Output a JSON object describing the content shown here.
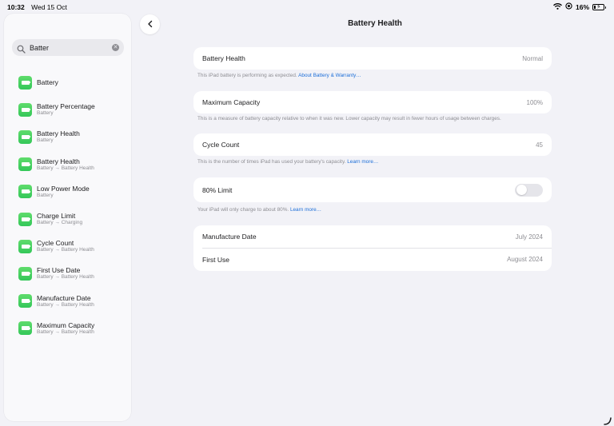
{
  "status_bar": {
    "time": "10:32",
    "date": "Wed 15 Oct",
    "battery_percent_text": "16%",
    "battery_level": 0.16,
    "icons": [
      "wifi-icon",
      "focus-icon",
      "battery-charging-icon"
    ]
  },
  "sidebar": {
    "search": {
      "value": "Batter"
    },
    "results": [
      {
        "title": "Battery",
        "subtitle": ""
      },
      {
        "title": "Battery Percentage",
        "subtitle": "Battery"
      },
      {
        "title": "Battery Health",
        "subtitle": "Battery"
      },
      {
        "title": "Battery Health",
        "subtitle": "Battery → Battery Health"
      },
      {
        "title": "Low Power Mode",
        "subtitle": "Battery"
      },
      {
        "title": "Charge Limit",
        "subtitle": "Battery → Charging"
      },
      {
        "title": "Cycle Count",
        "subtitle": "Battery → Battery Health"
      },
      {
        "title": "First Use Date",
        "subtitle": "Battery → Battery Health"
      },
      {
        "title": "Manufacture Date",
        "subtitle": "Battery → Battery Health"
      },
      {
        "title": "Maximum Capacity",
        "subtitle": "Battery → Battery Health"
      }
    ]
  },
  "main": {
    "title": "Battery Health",
    "battery_health": {
      "label": "Battery Health",
      "value": "Normal",
      "footnote": "This iPad battery is performing as expected.",
      "link": "About Battery & Warranty…"
    },
    "maximum_capacity": {
      "label": "Maximum Capacity",
      "value": "100%",
      "footnote": "This is a measure of battery capacity relative to when it was new. Lower capacity may result in fewer hours of usage between charges."
    },
    "cycle_count": {
      "label": "Cycle Count",
      "value": "45",
      "footnote": "This is the number of times iPad has used your battery's capacity.",
      "link": "Learn more…"
    },
    "limit_80": {
      "label": "80% Limit",
      "enabled": false,
      "footnote": "Your iPad will only charge to about 80%.",
      "link": "Learn more…"
    },
    "dates": {
      "manufacture_label": "Manufacture Date",
      "manufacture_value": "July 2024",
      "first_use_label": "First Use",
      "first_use_value": "August 2024"
    }
  },
  "colors": {
    "background": "#f2f2f7",
    "accent_link": "#1c6ed8",
    "battery_icon_green": "#34c759",
    "secondary_text": "#8e8e93"
  }
}
